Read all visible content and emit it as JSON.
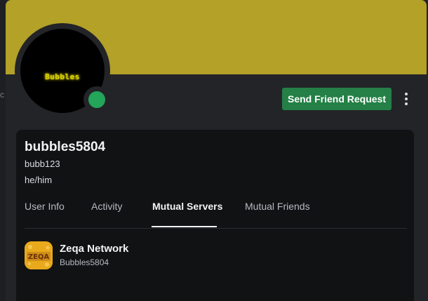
{
  "profile": {
    "banner_color": "#b3a128",
    "avatar_text": "Bubbles",
    "status": "online",
    "status_color": "#23a55a",
    "display_name": "bubbles5804",
    "username": "bubb123",
    "pronouns": "he/him"
  },
  "actions": {
    "send_friend_request_label": "Send Friend Request",
    "accent_color": "#248046",
    "more_icon": "more-vertical-icon"
  },
  "tabs": [
    {
      "label": "User Info",
      "active": false
    },
    {
      "label": "Activity",
      "active": false
    },
    {
      "label": "Mutual Servers",
      "active": true
    },
    {
      "label": "Mutual Friends",
      "active": false
    }
  ],
  "mutual_servers": [
    {
      "name": "Zeqa Network",
      "nickname": "Bubbles5804",
      "icon_text": "ZEQA"
    }
  ],
  "left_edge_glyph": "c"
}
